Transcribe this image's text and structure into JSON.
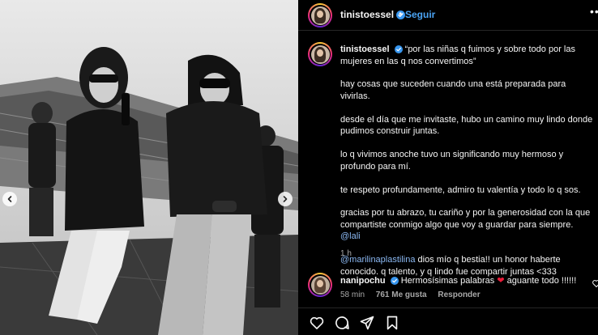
{
  "post": {
    "author": "tinistoessel",
    "follow_label": "Seguir",
    "separator": "•",
    "more_label": "•••"
  },
  "caption": {
    "author": "tinistoessel",
    "quote": "“por las niñas q fuimos y sobre todo por las mujeres en las q nos convertimos”",
    "p1": "hay cosas que suceden cuando una está preparada para vivirlas.",
    "p2": "desde el día que me invitaste, hubo un camino muy lindo donde pudimos construir juntas.",
    "p3": "lo q vivimos anoche tuvo un significando muy hermoso y profundo para mí.",
    "p4": "te respeto profundamente, admiro tu valentía y todo lo q sos.",
    "p5": "gracias por tu abrazo, tu cariño y por la generosidad con la que compartiste conmigo algo que voy a guardar para siempre.",
    "p5_mention": "@lali",
    "p6_mention": "@marilinaplastilina",
    "p6": "dios mío q bestia!! un honor haberte conocido. q talento, y q lindo fue compartir juntas <333",
    "time": "1 h"
  },
  "comment": {
    "author": "nanipochu",
    "text": "Hermosísimas palabras",
    "text_after": "aguante todo !!!!!!",
    "time": "58 min",
    "likes": "761 Me gusta",
    "reply_label": "Responder"
  },
  "colors": {
    "link": "#4aa3f3",
    "mention": "#8bb8f2",
    "heart": "#ed1c3a",
    "verified": "#3897f0"
  },
  "icons": [
    "heart-icon",
    "comment-icon",
    "share-icon",
    "save-icon",
    "chevron-left-icon",
    "chevron-right-icon",
    "verified-badge-icon"
  ]
}
